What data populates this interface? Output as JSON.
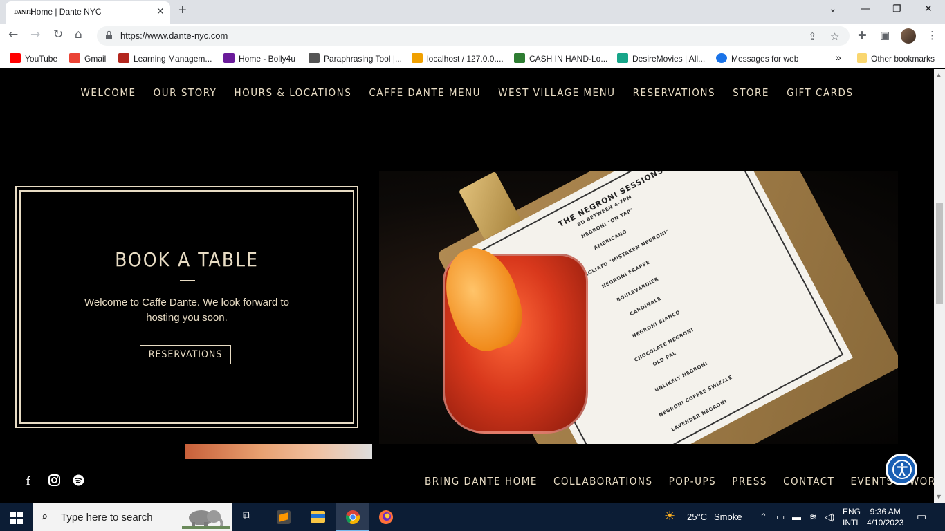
{
  "browser": {
    "tab_title": "Home | Dante NYC",
    "favicon_text": "DANTE",
    "url": "https://www.dante-nyc.com",
    "bookmarks": [
      {
        "label": "YouTube",
        "color": "#ff0000"
      },
      {
        "label": "Gmail",
        "color": "#ea4335"
      },
      {
        "label": "Learning Managem...",
        "color": "#b3261e"
      },
      {
        "label": "Home - Bolly4u",
        "color": "#6a1b9a"
      },
      {
        "label": "Paraphrasing Tool |...",
        "color": "#555555"
      },
      {
        "label": "localhost / 127.0.0....",
        "color": "#f0a000"
      },
      {
        "label": "CASH IN HAND-Lo...",
        "color": "#2e7d32"
      },
      {
        "label": "DesireMovies | All...",
        "color": "#17a589"
      },
      {
        "label": "Messages for web",
        "color": "#1a73e8"
      }
    ],
    "overflow_label": "»",
    "other_bookmarks": "Other bookmarks"
  },
  "site": {
    "top_nav": [
      "WELCOME",
      "OUR STORY",
      "HOURS & LOCATIONS",
      "CAFFE DANTE MENU",
      "WEST VILLAGE MENU",
      "RESERVATIONS",
      "STORE",
      "GIFT CARDS"
    ],
    "book": {
      "title": "BOOK A TABLE",
      "text": "Welcome to Caffe Dante. We look forward to hosting you soon.",
      "button": "RESERVATIONS"
    },
    "menu_card": {
      "title": "THE NEGRONI SESSIONS",
      "subtitle": "SD BETWEEN 4-7PM",
      "items": [
        "NEGRONI \"ON TAP\"",
        "AMERICANO",
        "SBAGLIATO \"MISTAKEN NEGRONI\"",
        "NEGRONI FRAPPE",
        "BOULEVARDIER",
        "CARDINALE",
        "NEGRONI BIANCO",
        "CHOCOLATE NEGRONI",
        "OLD PAL",
        "UNLIKELY NEGRONI",
        "NEGRONI COFFEE SWIZZLE",
        "LAVENDER NEGRONI"
      ]
    },
    "footer_nav": [
      "BRING DANTE HOME",
      "COLLABORATIONS",
      "POP-UPS",
      "PRESS",
      "CONTACT",
      "EVENTS",
      "WORK WITH US"
    ],
    "social_icons": [
      "facebook-icon",
      "instagram-icon",
      "spotify-icon"
    ],
    "accent": "#e8dcc4"
  },
  "taskbar": {
    "search_placeholder": "Type here to search",
    "weather_temp": "25°C",
    "weather_text": "Smoke",
    "lang_top": "ENG",
    "lang_bottom": "INTL",
    "time": "9:36 AM",
    "date": "4/10/2023"
  }
}
